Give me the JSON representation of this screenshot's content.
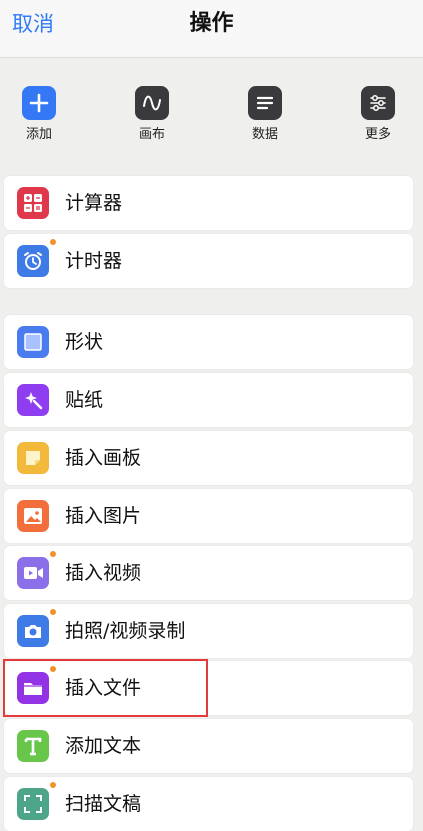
{
  "header": {
    "cancel": "取消",
    "title": "操作"
  },
  "toolbar": [
    {
      "label": "添加",
      "icon": "plus-icon",
      "color": "#3478f6"
    },
    {
      "label": "画布",
      "icon": "wave-icon",
      "color": "#3a3a3c"
    },
    {
      "label": "数据",
      "icon": "lines-icon",
      "color": "#3a3a3c"
    },
    {
      "label": "更多",
      "icon": "sliders-icon",
      "color": "#3a3a3c"
    }
  ],
  "group1": [
    {
      "label": "计算器",
      "icon": "calculator-icon",
      "color": "#e0384b"
    },
    {
      "label": "计时器",
      "icon": "alarm-clock-icon",
      "color": "#3e7be6"
    }
  ],
  "group2": [
    {
      "label": "形状",
      "icon": "square-icon",
      "color": "#4a7cf0"
    },
    {
      "label": "贴纸",
      "icon": "sparkle-icon",
      "color": "#8e3df1"
    },
    {
      "label": "插入画板",
      "icon": "note-icon",
      "color": "#f2b93b"
    },
    {
      "label": "插入图片",
      "icon": "image-icon",
      "color": "#f26f3b"
    },
    {
      "label": "插入视频",
      "icon": "video-icon",
      "color": "#8a6fe8"
    },
    {
      "label": "拍照/视频录制",
      "icon": "camera-icon",
      "color": "#3e7be6"
    },
    {
      "label": "插入文件",
      "icon": "folder-icon",
      "color": "#9233e6"
    },
    {
      "label": "添加文本",
      "icon": "text-t-icon",
      "color": "#68c74a"
    },
    {
      "label": "扫描文稿",
      "icon": "scan-icon",
      "color": "#4ea68a"
    }
  ]
}
